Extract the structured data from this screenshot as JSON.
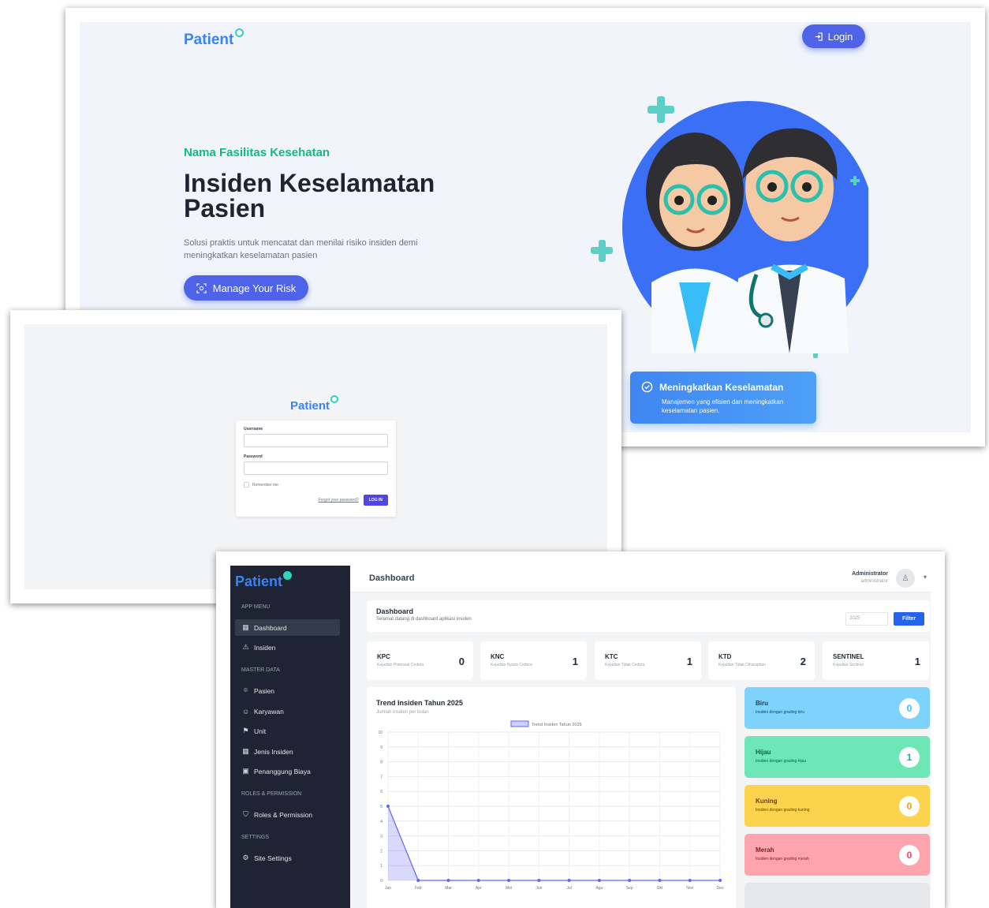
{
  "landing": {
    "logo": "Patient",
    "login_label": "Login",
    "facility_name": "Nama Fasilitas Kesehatan",
    "title": "Insiden Keselamatan Pasien",
    "subtitle": "Solusi praktis untuk mencatat dan menilai risiko insiden demi meningkatkan keselamatan pasien",
    "cta_label": "Manage Your Risk",
    "feature_card": {
      "title": "Meningkatkan Keselamatan",
      "description": "Manajemen yang efisien dan meningkatkan keselamatan pasien."
    }
  },
  "login": {
    "logo": "Patient",
    "username_label": "Username",
    "password_label": "Password",
    "remember_label": "Remember me",
    "forgot_label": "Forgot your password?",
    "submit_label": "LOG IN"
  },
  "dashboard": {
    "logo": "Patient",
    "page_title": "Dashboard",
    "user": {
      "name": "Administrator",
      "role": "administrator"
    },
    "sidebar": {
      "sections": [
        {
          "label": "APP MENU",
          "items": [
            {
              "label": "Dashboard",
              "icon": "grid-icon"
            },
            {
              "label": "Insiden",
              "icon": "warning-icon"
            }
          ]
        },
        {
          "label": "MASTER DATA",
          "items": [
            {
              "label": "Pasien",
              "icon": "scan-face-icon"
            },
            {
              "label": "Karyawan",
              "icon": "users-icon"
            },
            {
              "label": "Unit",
              "icon": "signpost-icon"
            },
            {
              "label": "Jenis Insiden",
              "icon": "grid-icon"
            },
            {
              "label": "Penanggung Biaya",
              "icon": "wallet-icon"
            }
          ]
        },
        {
          "label": "ROLES & PERMISSION",
          "items": [
            {
              "label": "Roles & Permission",
              "icon": "shield-icon"
            }
          ]
        },
        {
          "label": "SETTINGS",
          "items": [
            {
              "label": "Site Settings",
              "icon": "gear-icon"
            }
          ]
        }
      ]
    },
    "welcome": {
      "title": "Dashboard",
      "subtitle": "Selamat datang di dashboard aplikasi insiden"
    },
    "year_value": "2025",
    "filter_label": "Filter",
    "stats": [
      {
        "code": "KPC",
        "desc": "Kejadian Potensial Cedera",
        "value": "0"
      },
      {
        "code": "KNC",
        "desc": "Kejadian Nyaris Cedera",
        "value": "1"
      },
      {
        "code": "KTC",
        "desc": "Kejadian Tidak Cedera",
        "value": "1"
      },
      {
        "code": "KTD",
        "desc": "Kejadian Tidak Diharapkan",
        "value": "2"
      },
      {
        "code": "SENTINEL",
        "desc": "Kejadian Sentinel",
        "value": "1"
      }
    ],
    "chart_title": "Trend Insiden Tahun 2025",
    "chart_subtitle": "Jumlah insiden per bulan",
    "grades": [
      {
        "name": "Biru",
        "desc": "Insiden dengan grading biru",
        "value": "0",
        "bg": "#7dd3fc",
        "text": "#1e3a5f",
        "accent": "#38bdf8"
      },
      {
        "name": "Hijau",
        "desc": "Insiden dengan grading hijau",
        "value": "1",
        "bg": "#6ee7b7",
        "text": "#065f46",
        "accent": "#10b981"
      },
      {
        "name": "Kuning",
        "desc": "Insiden dengan grading kuning",
        "value": "0",
        "bg": "#fcd34d",
        "text": "#78350f",
        "accent": "#f59e0b"
      },
      {
        "name": "Merah",
        "desc": "Insiden dengan grading merah",
        "value": "0",
        "bg": "#fda4af",
        "text": "#7f1d1d",
        "accent": "#f43f5e"
      }
    ]
  },
  "chart_data": {
    "type": "area",
    "title": "Trend Insiden Tahun 2025",
    "subtitle": "Jumlah insiden per bulan",
    "categories": [
      "Jan",
      "Feb",
      "Mar",
      "Apr",
      "Mei",
      "Jun",
      "Jul",
      "Agu",
      "Sep",
      "Okt",
      "Nov",
      "Des"
    ],
    "series": [
      {
        "name": "Trend Insiden Tahun 2025",
        "values": [
          5,
          0,
          0,
          0,
          0,
          0,
          0,
          0,
          0,
          0,
          0,
          0
        ]
      }
    ],
    "ylim": [
      0,
      10
    ],
    "yticks": [
      "0",
      "1",
      "2",
      "3",
      "4",
      "5",
      "6",
      "7",
      "8",
      "9",
      "10"
    ],
    "grid": true,
    "legend": "top",
    "color": "#6366f1"
  }
}
